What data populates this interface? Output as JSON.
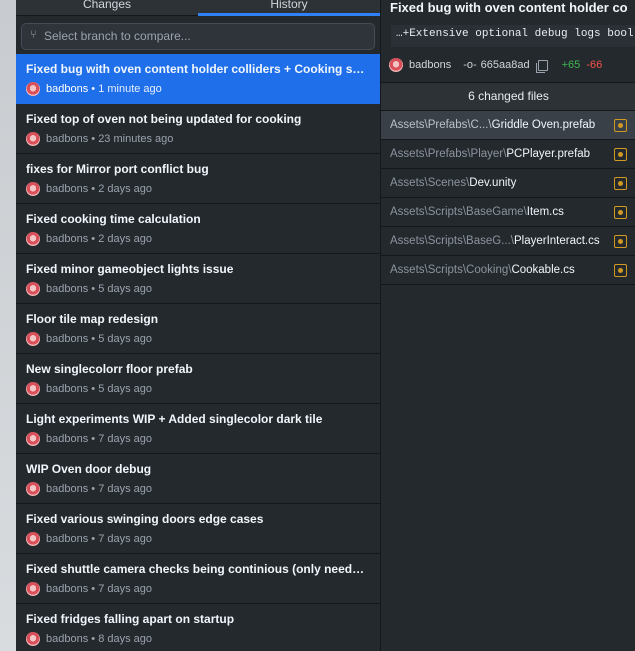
{
  "tabs": {
    "changes": "Changes",
    "history": "History"
  },
  "branch_compare": {
    "placeholder": "Select branch to compare..."
  },
  "commits": [
    {
      "title": "Fixed bug with oven content holder colliders + Cooking sou...",
      "author": "badbons",
      "time": "1 minute ago",
      "selected": true
    },
    {
      "title": "Fixed top of oven not being updated for cooking",
      "author": "badbons",
      "time": "23 minutes ago"
    },
    {
      "title": "fixes for Mirror port conflict bug",
      "author": "badbons",
      "time": "2 days ago"
    },
    {
      "title": "Fixed cooking time calculation",
      "author": "badbons",
      "time": "2 days ago"
    },
    {
      "title": "Fixed minor gameobject lights issue",
      "author": "badbons",
      "time": "5 days ago"
    },
    {
      "title": "Floor tile map redesign",
      "author": "badbons",
      "time": "5 days ago"
    },
    {
      "title": "New singlecolorr floor prefab",
      "author": "badbons",
      "time": "5 days ago"
    },
    {
      "title": "Light experiments WIP + Added singlecolor dark tile",
      "author": "badbons",
      "time": "7 days ago"
    },
    {
      "title": "WIP Oven door debug",
      "author": "badbons",
      "time": "7 days ago"
    },
    {
      "title": "Fixed various swinging doors edge cases",
      "author": "badbons",
      "time": "7 days ago"
    },
    {
      "title": "Fixed shuttle camera checks being continious (only needed ...",
      "author": "badbons",
      "time": "7 days ago"
    },
    {
      "title": "Fixed fridges falling apart on startup",
      "author": "badbons",
      "time": "8 days ago"
    }
  ],
  "detail": {
    "title": "Fixed bug with oven content holder co",
    "description": "…+Extensive optional debug logs bool",
    "author": "badbons",
    "sha": "665aa8ad",
    "additions": "+65",
    "deletions": "-66",
    "changed_files_label": "6 changed files"
  },
  "files": [
    {
      "path": "Assets\\Prefabs\\C...\\",
      "name": "Griddle Oven.prefab",
      "status": "modified",
      "selected": true
    },
    {
      "path": "Assets\\Prefabs\\Player\\",
      "name": "PCPlayer.prefab",
      "status": "modified"
    },
    {
      "path": "Assets\\Scenes\\",
      "name": "Dev.unity",
      "status": "modified"
    },
    {
      "path": "Assets\\Scripts\\BaseGame\\",
      "name": "Item.cs",
      "status": "modified"
    },
    {
      "path": "Assets\\Scripts\\BaseG...\\",
      "name": "PlayerInteract.cs",
      "status": "modified"
    },
    {
      "path": "Assets\\Scripts\\Cooking\\",
      "name": "Cookable.cs",
      "status": "modified"
    }
  ],
  "colors": {
    "accent": "#1f6feb",
    "added": "#3fb950",
    "removed": "#f85149",
    "modified": "#d29922"
  }
}
